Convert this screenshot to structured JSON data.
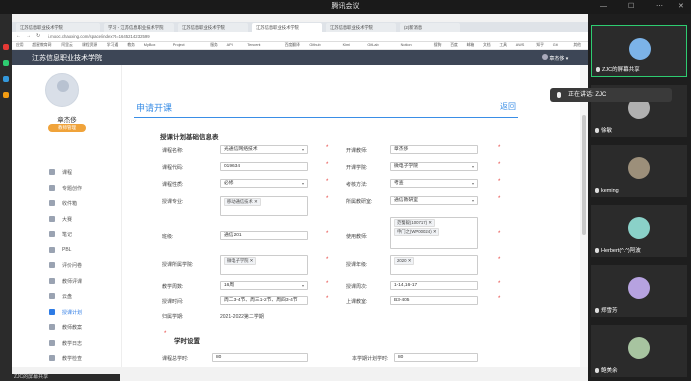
{
  "meeting": {
    "title": "腾讯会议"
  },
  "browser": {
    "tabs": [
      "江苏信息职业技术学院",
      "学习 - 江苏信息职业技术学院",
      "江苏信息职业技术学院",
      "江苏信息职业技术学院",
      "江苏信息职业技术学院",
      "(2)新消息"
    ],
    "url": "i.mooc.chaoxing.com/space/index?t=1645214232599",
    "bookmarks": [
      "应用",
      "超星教育网",
      "阿里云",
      "课程资源",
      "学习通",
      "教务",
      "MyBox",
      "Project",
      "服务",
      "API",
      "Tencent",
      "百度翻译",
      "Github",
      "Kimi",
      "GitLab",
      "Notion",
      "搜狗",
      "百度",
      "邮箱",
      "文档",
      "工具",
      "AWS",
      "知乎",
      "Git",
      "其他"
    ]
  },
  "app": {
    "school": "江苏信息职业技术学院",
    "user": "章杰侈"
  },
  "sidebar": {
    "name": "章杰侈",
    "badge": "教师管理",
    "items": [
      {
        "label": "课程"
      },
      {
        "label": "专题创作"
      },
      {
        "label": "收件箱"
      },
      {
        "label": "大赛"
      },
      {
        "label": "笔记"
      },
      {
        "label": "PBL"
      },
      {
        "label": "评价问卷"
      },
      {
        "label": "教师评课"
      },
      {
        "label": "云盘"
      },
      {
        "label": "授课计划"
      },
      {
        "label": "教师教案"
      },
      {
        "label": "教学日志"
      },
      {
        "label": "教学检查"
      }
    ]
  },
  "form": {
    "title": "申请开课",
    "back": "返回",
    "section1": "授课计划基础信息表",
    "section2": "学时设置",
    "course_name_label": "课程名称:",
    "course_name": "光通信网络技术",
    "course_code_label": "课程代码:",
    "course_code": "019634",
    "course_type_label": "课程性质:",
    "course_type": "必修",
    "major_label": "授课专业:",
    "major_tag": "移动通信技术",
    "class_label": "班级:",
    "class_value": "通信201",
    "dept_label": "授课所属学院:",
    "dept_tag": "微电子学院",
    "credit_label": "教学周数:",
    "credit": "16周",
    "time_label": "授课时间:",
    "time_value": "周二3-4节、周三1-2节、周四3-4节",
    "term_label": "归属学期:",
    "term": "2021-2022第二学期",
    "teacher_label": "开课教师:",
    "teacher": "章杰侈",
    "college_label": "开课学院:",
    "college": "微电子学院",
    "exam_label": "考核方法:",
    "exam": "考查",
    "room_label": "所属教研室:",
    "room": "通信教研室",
    "coteacher_label": "使用教师:",
    "coteachers": [
      "范蜀毅(100717)",
      "申门之(WP00024)"
    ],
    "year_label": "授课年级:",
    "year_tag": "2020",
    "week_label": "授课周次:",
    "week": "1-14,16-17",
    "place_label": "上课教室:",
    "place": "B3-405",
    "hours_label": "课程总学时:",
    "hours": "80",
    "term_hours_label": "本学期计划学时:",
    "term_hours": "80"
  },
  "participants": [
    {
      "name": "ZJC的屏幕共享",
      "color": "#7cb3e8"
    },
    {
      "name": "徐敏",
      "color": "#b0b0b0"
    },
    {
      "name": "keming",
      "color": "#9c8f7a"
    },
    {
      "name": "Herbert(^.^)阿波",
      "color": "#8ad1c8"
    },
    {
      "name": "郑雪芳",
      "color": "#b6a2e0"
    },
    {
      "name": "鲍美余",
      "color": "#a7c4a0"
    }
  ],
  "speaking": "正在讲话: ZJC",
  "bottom": "ZJC的屏幕共享"
}
